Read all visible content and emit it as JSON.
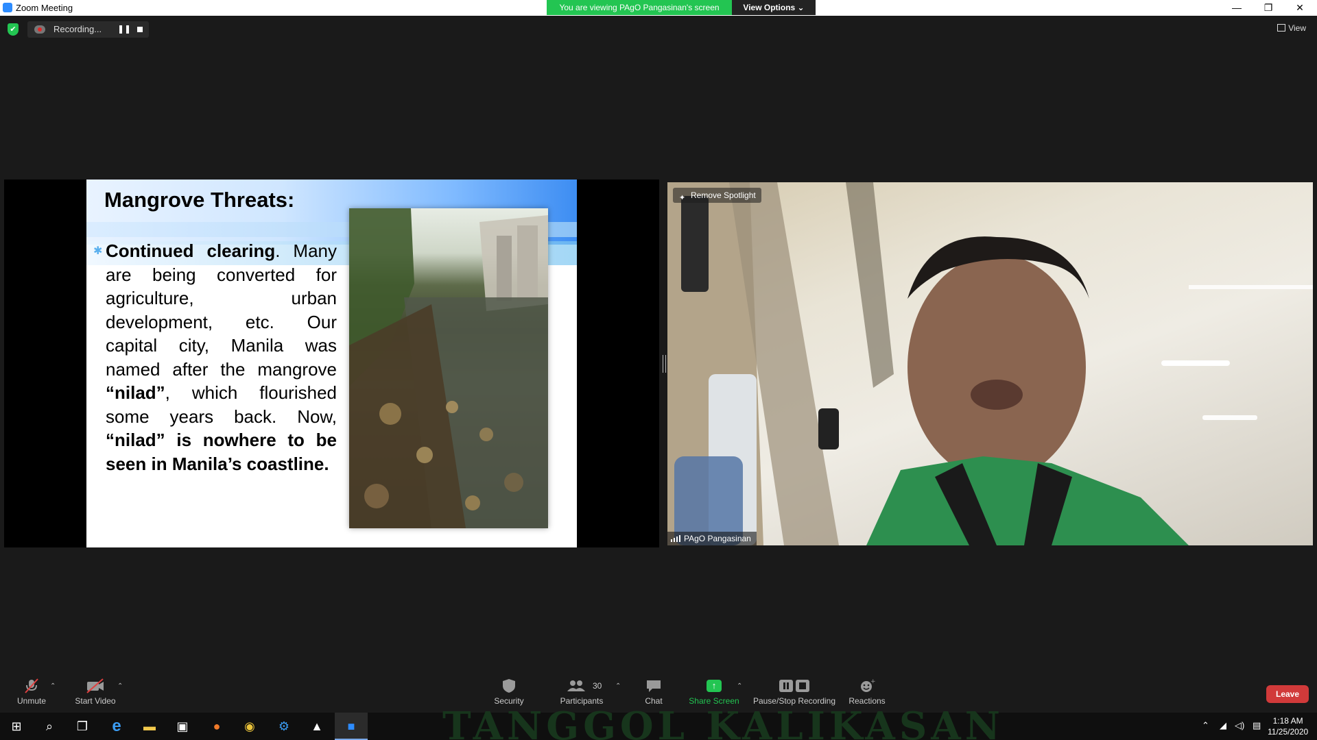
{
  "window": {
    "title": "Zoom Meeting",
    "viewing_banner": "You are viewing PAgO Pangasinan's screen",
    "view_options": "View Options ⌄",
    "minimize": "—",
    "restore": "❐",
    "close": "✕"
  },
  "meeting": {
    "recording_label": "Recording...",
    "pause_icon": "❚❚",
    "view_label": "View",
    "shield": "✔"
  },
  "slide": {
    "title": "Mangrove Threats:",
    "bullet": "✱",
    "p1_bold": "Continued clearing",
    "p1_rest": ". Many are being converted for agriculture, urban development, etc. Our capital city, Manila was named after the mangrove ",
    "p1_quote": "“nilad”",
    "p1_after": ", which flourished some years back. Now, ",
    "p1_end_bold": "“nilad” is nowhere to be seen in Manila’s coastline."
  },
  "video": {
    "spotlight": "Remove Spotlight",
    "pin_icon": "✦",
    "participant_name": "PAgO Pangasinan"
  },
  "toolbar": {
    "unmute": "Unmute",
    "start_video": "Start Video",
    "security": "Security",
    "participants": "Participants",
    "participants_count": "30",
    "chat": "Chat",
    "share_screen": "Share Screen",
    "share_arrow": "↑",
    "pause_stop_recording": "Pause/Stop Recording",
    "reactions": "Reactions",
    "leave": "Leave",
    "caret": "⌃"
  },
  "taskbar": {
    "background_text": "TANGGOL KALIKASAN",
    "time": "1:18 AM",
    "date": "11/25/2020",
    "start_icon": "⊞",
    "search_icon": "⌕",
    "taskview_icon": "❐",
    "edge_icon": "e",
    "explorer_icon": "▬",
    "store_icon": "▣",
    "firefox_icon": "●",
    "chrome_icon": "◉",
    "settings_icon": "⚙",
    "photos_icon": "▲",
    "zoom_icon": "■",
    "tray_up": "⌃",
    "tray_network": "◢",
    "tray_volume": "◁)",
    "tray_notify": "▤"
  },
  "colors": {
    "zoom_green": "#23c552",
    "leave_red": "#d13a3a",
    "zoom_blue": "#2d8cff"
  }
}
